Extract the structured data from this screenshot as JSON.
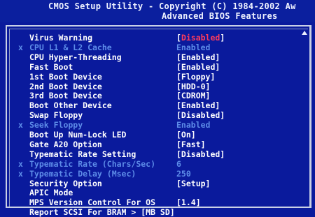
{
  "header": {
    "line1": "CMOS Setup Utility - Copyright (C) 1984-2002 Aw",
    "line2": "Advanced BIOS Features"
  },
  "colors": {
    "background": "#0a1a9c",
    "active_text": "#ffffff",
    "inactive_text": "#5d8ce8",
    "selected_value": "#ff3b5c"
  },
  "settings": [
    {
      "marker": "",
      "label": "Virus Warning",
      "value": "[Disabled]",
      "state": "active",
      "selected": true
    },
    {
      "marker": "x",
      "label": "CPU L1 & L2 Cache",
      "value": "Enabled",
      "state": "inactive",
      "selected": false
    },
    {
      "marker": "",
      "label": "CPU Hyper-Threading",
      "value": "[Enabled]",
      "state": "active",
      "selected": false
    },
    {
      "marker": "",
      "label": "Fast Boot",
      "value": "[Enabled]",
      "state": "active",
      "selected": false
    },
    {
      "marker": "",
      "label": "1st Boot Device",
      "value": "[Floppy]",
      "state": "active",
      "selected": false
    },
    {
      "marker": "",
      "label": "2nd Boot Device",
      "value": "[HDD-0]",
      "state": "active",
      "selected": false
    },
    {
      "marker": "",
      "label": "3rd Boot Device",
      "value": "[CDROM]",
      "state": "active",
      "selected": false
    },
    {
      "marker": "",
      "label": "Boot Other Device",
      "value": "[Enabled]",
      "state": "active",
      "selected": false
    },
    {
      "marker": "",
      "label": "Swap Floppy",
      "value": "[Disabled]",
      "state": "active",
      "selected": false
    },
    {
      "marker": "x",
      "label": "Seek Floppy",
      "value": "Enabled",
      "state": "inactive",
      "selected": false
    },
    {
      "marker": "",
      "label": "Boot Up Num-Lock LED",
      "value": "[On]",
      "state": "active",
      "selected": false
    },
    {
      "marker": "",
      "label": "Gate A20 Option",
      "value": "[Fast]",
      "state": "active",
      "selected": false
    },
    {
      "marker": "",
      "label": "Typematic Rate Setting",
      "value": "[Disabled]",
      "state": "active",
      "selected": false
    },
    {
      "marker": "x",
      "label": "Typematic Rate (Chars/Sec)",
      "value": "6",
      "state": "inactive",
      "selected": false
    },
    {
      "marker": "x",
      "label": "Typematic Delay (Msec)",
      "value": "250",
      "state": "inactive",
      "selected": false
    },
    {
      "marker": "",
      "label": "Security Option",
      "value": "[Setup]",
      "state": "active",
      "selected": false
    },
    {
      "marker": "",
      "label": "APIC Mode",
      "value": "",
      "state": "active",
      "selected": false
    },
    {
      "marker": "",
      "label": "MPS Version Control For OS",
      "value": "[1.4]",
      "state": "active",
      "selected": false
    },
    {
      "marker": "",
      "label": "Report SCSI For BRAM > [MB SD]",
      "value": "",
      "state": "active",
      "selected": false
    }
  ]
}
